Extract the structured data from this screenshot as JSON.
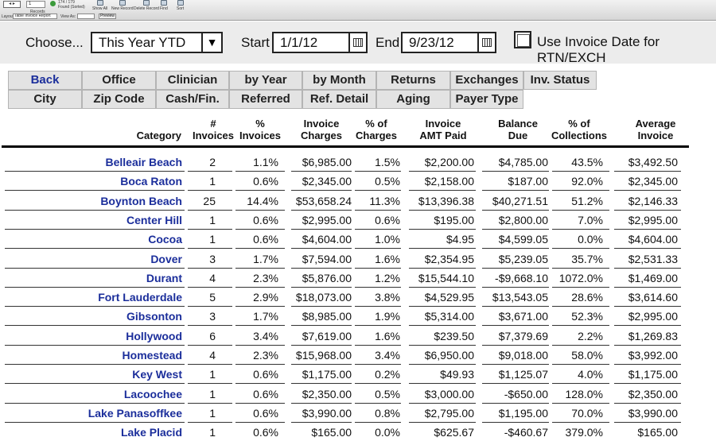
{
  "toolbar": {
    "nav_label": "◂ ▸",
    "record_num": "1",
    "records_label": "Records",
    "found_count": "174 / 179",
    "found_label": "Found (Sorted)",
    "items": [
      {
        "label": "Show All"
      },
      {
        "label": "New Record"
      },
      {
        "label": "Delete Record"
      },
      {
        "label": "Find"
      },
      {
        "label": "Sort"
      }
    ],
    "layout_label": "Layout:",
    "layout_value": "Table Invoice Report",
    "view_as_label": "View As:",
    "preview_label": "Preview"
  },
  "filter": {
    "choose_label": "Choose...",
    "choose_value": "This Year YTD",
    "start_label": "Start",
    "start_value": "1/1/12",
    "end_label": "End",
    "end_value": "9/23/12",
    "invoice_date_label": "Use Invoice Date for RTN/EXCH"
  },
  "buttons_row1": [
    "Back",
    "Office",
    "Clinician",
    "by Year",
    "by Month",
    "Returns",
    "Exchanges",
    "Inv. Status"
  ],
  "buttons_row2": [
    "City",
    "Zip Code",
    "Cash/Fin.",
    "Referred",
    "Ref. Detail",
    "Aging",
    "Payer Type"
  ],
  "table": {
    "headers": {
      "category": "Category",
      "num_invoices_1": "#",
      "num_invoices_2": "Invoices",
      "pct_invoices_1": "%",
      "pct_invoices_2": "Invoices",
      "charges_1": "Invoice",
      "charges_2": "Charges",
      "pct_charges_1": "% of",
      "pct_charges_2": "Charges",
      "amt_paid_1": "Invoice",
      "amt_paid_2": "AMT Paid",
      "balance_1": "Balance",
      "balance_2": "Due",
      "collections_1": "% of",
      "collections_2": "Collections",
      "average_1": "Average",
      "average_2": "Invoice"
    },
    "rows": [
      {
        "category": "Belleair Beach",
        "invoices": "2",
        "pct_invoices": "1.1%",
        "charges": "$6,985.00",
        "pct_charges": "1.5%",
        "paid": "$2,200.00",
        "balance": "$4,785.00",
        "collections": "43.5%",
        "average": "$3,492.50"
      },
      {
        "category": "Boca Raton",
        "invoices": "1",
        "pct_invoices": "0.6%",
        "charges": "$2,345.00",
        "pct_charges": "0.5%",
        "paid": "$2,158.00",
        "balance": "$187.00",
        "collections": "92.0%",
        "average": "$2,345.00"
      },
      {
        "category": "Boynton Beach",
        "invoices": "25",
        "pct_invoices": "14.4%",
        "charges": "$53,658.24",
        "pct_charges": "11.3%",
        "paid": "$13,396.38",
        "balance": "$40,271.51",
        "collections": "51.2%",
        "average": "$2,146.33"
      },
      {
        "category": "Center Hill",
        "invoices": "1",
        "pct_invoices": "0.6%",
        "charges": "$2,995.00",
        "pct_charges": "0.6%",
        "paid": "$195.00",
        "balance": "$2,800.00",
        "collections": "7.0%",
        "average": "$2,995.00"
      },
      {
        "category": "Cocoa",
        "invoices": "1",
        "pct_invoices": "0.6%",
        "charges": "$4,604.00",
        "pct_charges": "1.0%",
        "paid": "$4.95",
        "balance": "$4,599.05",
        "collections": "0.0%",
        "average": "$4,604.00"
      },
      {
        "category": "Dover",
        "invoices": "3",
        "pct_invoices": "1.7%",
        "charges": "$7,594.00",
        "pct_charges": "1.6%",
        "paid": "$2,354.95",
        "balance": "$5,239.05",
        "collections": "35.7%",
        "average": "$2,531.33"
      },
      {
        "category": "Durant",
        "invoices": "4",
        "pct_invoices": "2.3%",
        "charges": "$5,876.00",
        "pct_charges": "1.2%",
        "paid": "$15,544.10",
        "balance": "-$9,668.10",
        "collections": "1072.0%",
        "average": "$1,469.00"
      },
      {
        "category": "Fort Lauderdale",
        "invoices": "5",
        "pct_invoices": "2.9%",
        "charges": "$18,073.00",
        "pct_charges": "3.8%",
        "paid": "$4,529.95",
        "balance": "$13,543.05",
        "collections": "28.6%",
        "average": "$3,614.60"
      },
      {
        "category": "Gibsonton",
        "invoices": "3",
        "pct_invoices": "1.7%",
        "charges": "$8,985.00",
        "pct_charges": "1.9%",
        "paid": "$5,314.00",
        "balance": "$3,671.00",
        "collections": "52.3%",
        "average": "$2,995.00"
      },
      {
        "category": "Hollywood",
        "invoices": "6",
        "pct_invoices": "3.4%",
        "charges": "$7,619.00",
        "pct_charges": "1.6%",
        "paid": "$239.50",
        "balance": "$7,379.69",
        "collections": "2.2%",
        "average": "$1,269.83"
      },
      {
        "category": "Homestead",
        "invoices": "4",
        "pct_invoices": "2.3%",
        "charges": "$15,968.00",
        "pct_charges": "3.4%",
        "paid": "$6,950.00",
        "balance": "$9,018.00",
        "collections": "58.0%",
        "average": "$3,992.00"
      },
      {
        "category": "Key West",
        "invoices": "1",
        "pct_invoices": "0.6%",
        "charges": "$1,175.00",
        "pct_charges": "0.2%",
        "paid": "$49.93",
        "balance": "$1,125.07",
        "collections": "4.0%",
        "average": "$1,175.00"
      },
      {
        "category": "Lacoochee",
        "invoices": "1",
        "pct_invoices": "0.6%",
        "charges": "$2,350.00",
        "pct_charges": "0.5%",
        "paid": "$3,000.00",
        "balance": "-$650.00",
        "collections": "128.0%",
        "average": "$2,350.00"
      },
      {
        "category": "Lake Panasoffkee",
        "invoices": "1",
        "pct_invoices": "0.6%",
        "charges": "$3,990.00",
        "pct_charges": "0.8%",
        "paid": "$2,795.00",
        "balance": "$1,195.00",
        "collections": "70.0%",
        "average": "$3,990.00"
      },
      {
        "category": "Lake Placid",
        "invoices": "1",
        "pct_invoices": "0.6%",
        "charges": "$165.00",
        "pct_charges": "0.0%",
        "paid": "$625.67",
        "balance": "-$460.67",
        "collections": "379.0%",
        "average": "$165.00"
      }
    ]
  }
}
